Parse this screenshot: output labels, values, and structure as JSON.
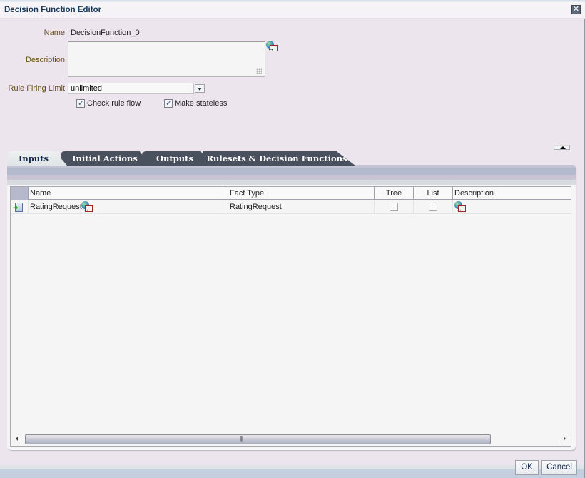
{
  "dialog": {
    "title": "Decision Function Editor",
    "close_icon": "close-icon"
  },
  "form": {
    "name_label": "Name",
    "name_value": "DecisionFunction_0",
    "description_label": "Description",
    "description_value": "",
    "description_icon": "translate-globe-icon",
    "rule_firing_limit_label": "Rule Firing Limit",
    "rule_firing_limit_value": "unlimited",
    "check_rule_flow": {
      "label": "Check rule flow",
      "checked": true
    },
    "make_stateless": {
      "label": "Make stateless",
      "checked": true
    }
  },
  "tabs": [
    {
      "label": "Inputs",
      "active": true
    },
    {
      "label": "Initial Actions",
      "active": false
    },
    {
      "label": "Outputs",
      "active": false
    },
    {
      "label": "Rulesets & Decision Functions",
      "active": false
    }
  ],
  "table": {
    "columns": [
      "Name",
      "Fact Type",
      "Tree",
      "List",
      "Description"
    ],
    "rows": [
      {
        "icon": "input-arrow-icon",
        "name": "RatingRequest",
        "fact_type": "RatingRequest",
        "tree": false,
        "list": false,
        "description_icon": "translate-globe-icon"
      }
    ]
  },
  "footer": {
    "ok_label": "OK",
    "cancel_label": "Cancel"
  }
}
